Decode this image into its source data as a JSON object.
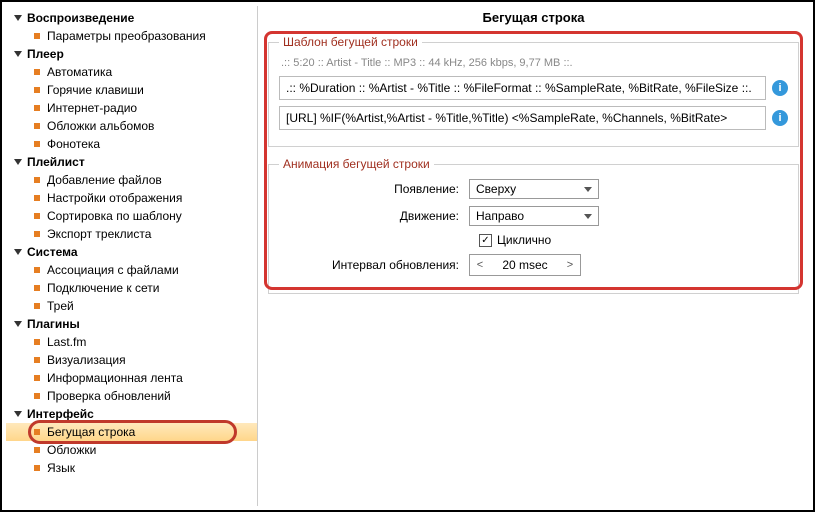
{
  "sidebar": {
    "groups": [
      {
        "label": "Воспроизведение",
        "items": [
          "Параметры преобразования"
        ]
      },
      {
        "label": "Плеер",
        "items": [
          "Автоматика",
          "Горячие клавиши",
          "Интернет-радио",
          "Обложки альбомов",
          "Фонотека"
        ]
      },
      {
        "label": "Плейлист",
        "items": [
          "Добавление файлов",
          "Настройки отображения",
          "Сортировка по шаблону",
          "Экспорт треклиста"
        ]
      },
      {
        "label": "Система",
        "items": [
          "Ассоциация с файлами",
          "Подключение к сети",
          "Трей"
        ]
      },
      {
        "label": "Плагины",
        "items": [
          "Last.fm",
          "Визуализация",
          "Информационная лента",
          "Проверка обновлений"
        ]
      },
      {
        "label": "Интерфейс",
        "items": [
          "Бегущая строка",
          "Обложки",
          "Язык"
        ]
      }
    ],
    "selected": "Бегущая строка"
  },
  "main": {
    "title": "Бегущая строка",
    "template_section": {
      "legend": "Шаблон бегущей строки",
      "preview": ".:: 5:20 :: Artist - Title :: MP3 :: 44 kHz, 256 kbps, 9,77 MB ::.",
      "line1": ".:: %Duration :: %Artist - %Title :: %FileFormat :: %SampleRate, %BitRate, %FileSize ::.",
      "line2": "[URL] %IF(%Artist,%Artist - %Title,%Title) <%SampleRate, %Channels, %BitRate>"
    },
    "animation_section": {
      "legend": "Анимация бегущей строки",
      "appearance_label": "Появление:",
      "appearance_value": "Сверху",
      "movement_label": "Движение:",
      "movement_value": "Направо",
      "cyclic_label": "Циклично",
      "cyclic_checked": true,
      "interval_label": "Интервал обновления:",
      "interval_value": "20 msec"
    }
  }
}
